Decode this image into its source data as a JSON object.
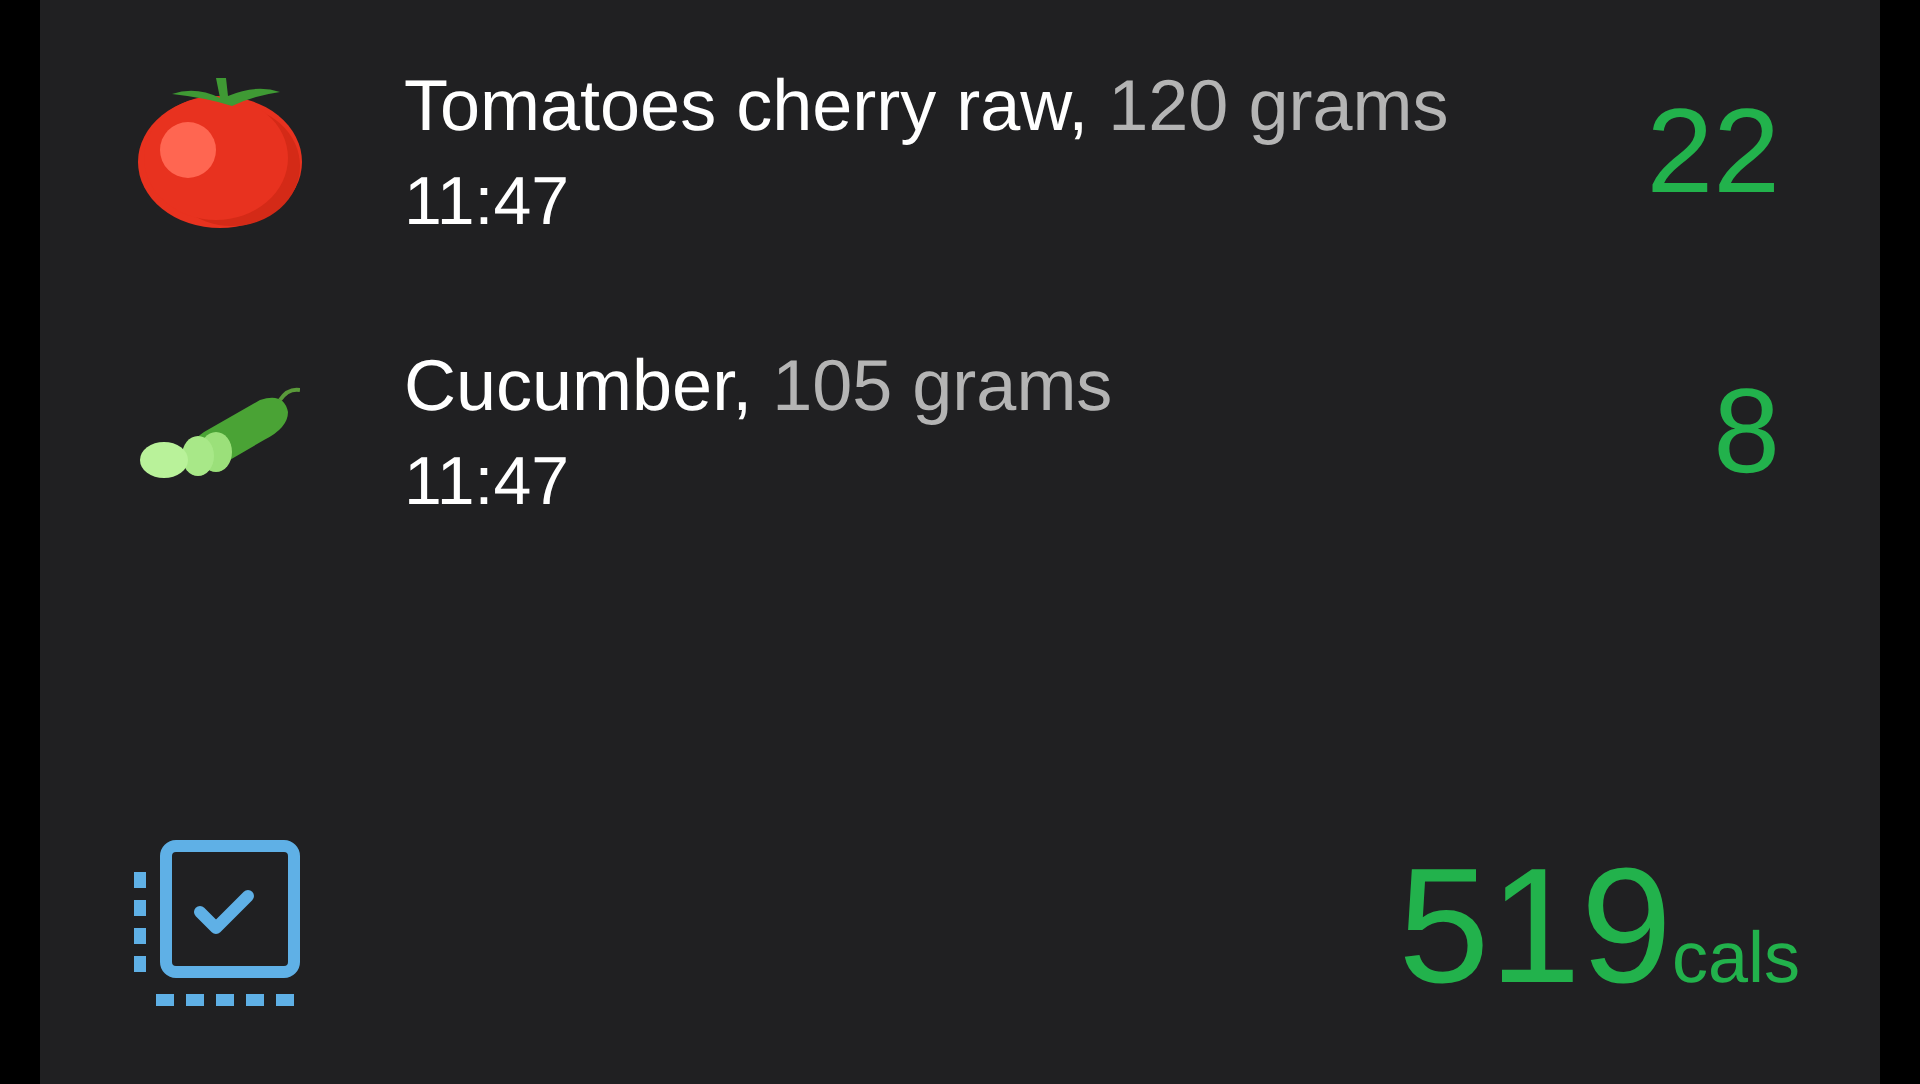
{
  "entries": [
    {
      "kind": "tomato",
      "name": "Tomatoes cherry raw,",
      "amount": "120 grams",
      "time": "11:47",
      "calories": "22"
    },
    {
      "kind": "cucumber",
      "name": "Cucumber,",
      "amount": "105 grams",
      "time": "11:47",
      "calories": "8"
    }
  ],
  "footer": {
    "total": "519",
    "unit": "cals"
  }
}
